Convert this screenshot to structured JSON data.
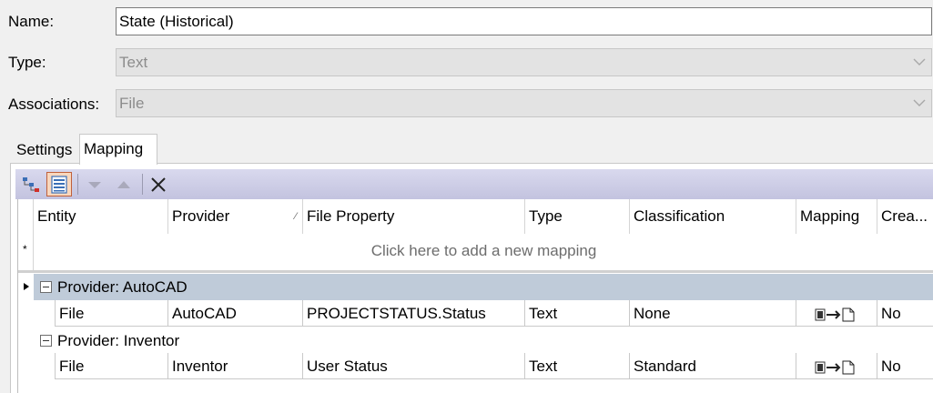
{
  "form": {
    "name_label": "Name:",
    "name_value": "State (Historical)",
    "type_label": "Type:",
    "type_value": "Text",
    "assoc_label": "Associations:",
    "assoc_value": "File"
  },
  "tabs": [
    {
      "label": "Settings",
      "active": false
    },
    {
      "label": "Mapping",
      "active": true
    }
  ],
  "toolbar": {
    "buttons": [
      "tree-view-icon",
      "list-view-icon",
      "move-down-icon",
      "move-up-icon",
      "delete-icon"
    ]
  },
  "grid": {
    "columns": [
      "Entity",
      "Provider",
      "File Property",
      "Type",
      "Classification",
      "Mapping",
      "Crea..."
    ],
    "sort_glyph": "⁄",
    "new_row_marker": "*",
    "new_row_text": "Click here to add a new mapping",
    "groups": [
      {
        "label": "Provider: AutoCAD",
        "rows": [
          {
            "entity": "File",
            "provider": "AutoCAD",
            "file_property": "PROJECTSTATUS.Status",
            "type": "Text",
            "classification": "None",
            "create": "No"
          }
        ]
      },
      {
        "label": "Provider: Inventor",
        "rows": [
          {
            "entity": "File",
            "provider": "Inventor",
            "file_property": "User Status",
            "type": "Text",
            "classification": "Standard",
            "create": "No"
          }
        ]
      }
    ]
  },
  "colors": {
    "toolbar_bg": "#c9c9e4",
    "group_selected_bg": "#bfcbd9",
    "pressed_border": "#c0603a"
  }
}
